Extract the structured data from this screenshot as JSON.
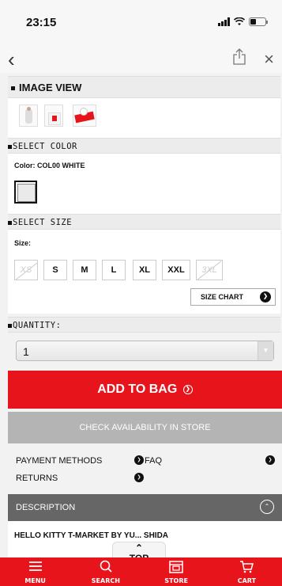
{
  "status_bar": {
    "time": "23:15"
  },
  "image_view": {
    "header": "IMAGE VIEW",
    "thumbnails": [
      "tshirt-front",
      "tshirt-back",
      "tshirt-packaging"
    ]
  },
  "select_color": {
    "header": "SELECT COLOR",
    "label": "Color: COL00 WHITE",
    "swatch_color": "#eaeaea"
  },
  "select_size": {
    "header": "SELECT SIZE",
    "label": "Size:",
    "sizes": [
      {
        "label": "XS",
        "available": false
      },
      {
        "label": "S",
        "available": true
      },
      {
        "label": "M",
        "available": true
      },
      {
        "label": "L",
        "available": true
      },
      {
        "label": "XL",
        "available": true
      },
      {
        "label": "XXL",
        "available": true
      },
      {
        "label": "3XL",
        "available": false
      }
    ],
    "size_chart": "SIZE CHART"
  },
  "quantity": {
    "header": "QUANTITY:",
    "value": "1"
  },
  "actions": {
    "add_to_bag": "ADD TO BAG",
    "check_availability": "CHECK AVAILABILITY IN STORE"
  },
  "links": {
    "payment_methods": "PAYMENT METHODS",
    "faq": "FAQ",
    "returns": "RETURNS"
  },
  "description": {
    "label": "DESCRIPTION"
  },
  "product_line": "HELLO KITTY T-MARKET BY YU... SHIDA",
  "top_button": "TOP",
  "tab_bar": {
    "menu": "MENU",
    "search": "SEARCH",
    "store": "STORE",
    "cart": "CART"
  },
  "colors": {
    "brand_red": "#e8141b",
    "gray_button": "#b4b4b4",
    "desc_bar": "#666666"
  }
}
